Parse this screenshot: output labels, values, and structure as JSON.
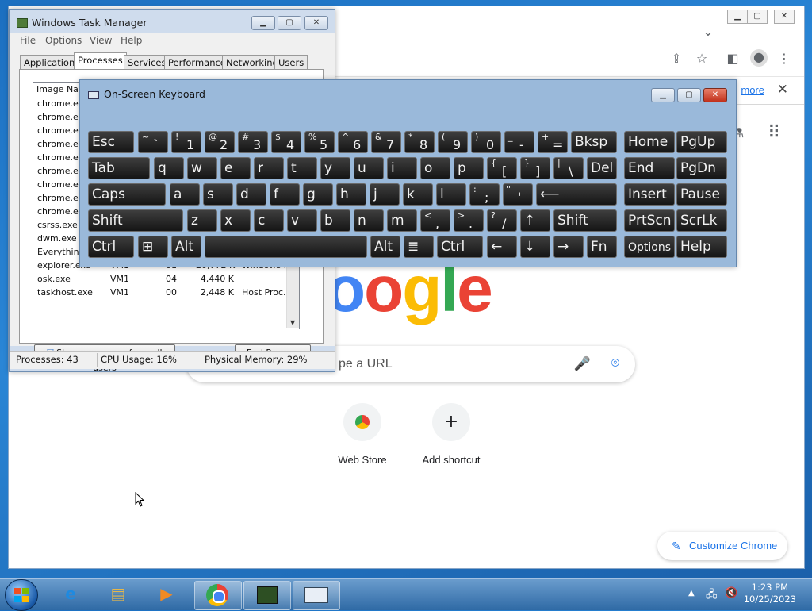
{
  "chrome": {
    "banner_link": "more",
    "banner_close": "✕",
    "search_placeholder": "pe a URL",
    "shortcuts": [
      {
        "label": "Web Store"
      },
      {
        "label": "Add shortcut",
        "icon": "+"
      }
    ],
    "customize_label": "Customize Chrome",
    "google_letters": [
      "o",
      "o",
      "g",
      "l",
      "e"
    ]
  },
  "task_manager": {
    "title": "Windows Task Manager",
    "menu": [
      "File",
      "Options",
      "View",
      "Help"
    ],
    "tabs": [
      "Applications",
      "Processes",
      "Services",
      "Performance",
      "Networking",
      "Users"
    ],
    "active_tab": "Processes",
    "column_header": "Image Nam",
    "rows": [
      {
        "name": "chrome.exe",
        "user": "",
        "cpu": "",
        "mem": "",
        "desc": ""
      },
      {
        "name": "chrome.exe",
        "user": "",
        "cpu": "",
        "mem": "",
        "desc": ""
      },
      {
        "name": "chrome.exe",
        "user": "",
        "cpu": "",
        "mem": "",
        "desc": ""
      },
      {
        "name": "chrome.exe",
        "user": "",
        "cpu": "",
        "mem": "",
        "desc": ""
      },
      {
        "name": "chrome.exe",
        "user": "",
        "cpu": "",
        "mem": "",
        "desc": ""
      },
      {
        "name": "chrome.exe",
        "user": "",
        "cpu": "",
        "mem": "",
        "desc": ""
      },
      {
        "name": "chrome.exe",
        "user": "",
        "cpu": "",
        "mem": "",
        "desc": ""
      },
      {
        "name": "chrome.exe",
        "user": "",
        "cpu": "",
        "mem": "",
        "desc": ""
      },
      {
        "name": "chrome.exe",
        "user": "",
        "cpu": "",
        "mem": "",
        "desc": ""
      },
      {
        "name": "csrss.exe",
        "user": "",
        "cpu": "",
        "mem": "",
        "desc": ""
      },
      {
        "name": "dwm.exe",
        "user": "",
        "cpu": "",
        "mem": "",
        "desc": ""
      },
      {
        "name": "Everything",
        "user": "",
        "cpu": "",
        "mem": "",
        "desc": ""
      },
      {
        "name": "explorer.exe",
        "user": "VM1",
        "cpu": "01",
        "mem": "20,772 K",
        "desc": "Windows ..."
      },
      {
        "name": "osk.exe",
        "user": "VM1",
        "cpu": "04",
        "mem": "4,440 K",
        "desc": ""
      },
      {
        "name": "taskhost.exe",
        "user": "VM1",
        "cpu": "00",
        "mem": "2,448 K",
        "desc": "Host Proc..."
      }
    ],
    "show_all_button": "Show processes from all users",
    "end_process_button": "End Process",
    "status": {
      "processes": "Processes: 43",
      "cpu": "CPU Usage: 16%",
      "memory": "Physical Memory: 29%"
    }
  },
  "osk": {
    "title": "On-Screen Keyboard",
    "rows": [
      [
        {
          "l": "Esc"
        },
        {
          "s": "~",
          "m": "`"
        },
        {
          "s": "!",
          "m": "1"
        },
        {
          "s": "@",
          "m": "2"
        },
        {
          "s": "#",
          "m": "3"
        },
        {
          "s": "$",
          "m": "4"
        },
        {
          "s": "%",
          "m": "5"
        },
        {
          "s": "^",
          "m": "6"
        },
        {
          "s": "&",
          "m": "7"
        },
        {
          "s": "*",
          "m": "8"
        },
        {
          "s": "(",
          "m": "9"
        },
        {
          "s": ")",
          "m": "0"
        },
        {
          "s": "_",
          "m": "-"
        },
        {
          "s": "+",
          "m": "="
        },
        {
          "l": "Bksp"
        },
        {
          "l": "Home"
        },
        {
          "l": "PgUp"
        }
      ],
      [
        {
          "l": "Tab"
        },
        {
          "l": "q"
        },
        {
          "l": "w"
        },
        {
          "l": "e"
        },
        {
          "l": "r"
        },
        {
          "l": "t"
        },
        {
          "l": "y"
        },
        {
          "l": "u"
        },
        {
          "l": "i"
        },
        {
          "l": "o"
        },
        {
          "l": "p"
        },
        {
          "s": "{",
          "m": "["
        },
        {
          "s": "}",
          "m": "]"
        },
        {
          "s": "|",
          "m": "\\"
        },
        {
          "l": "Del"
        },
        {
          "l": "End"
        },
        {
          "l": "PgDn"
        }
      ],
      [
        {
          "l": "Caps"
        },
        {
          "l": "a"
        },
        {
          "l": "s"
        },
        {
          "l": "d"
        },
        {
          "l": "f"
        },
        {
          "l": "g"
        },
        {
          "l": "h"
        },
        {
          "l": "j"
        },
        {
          "l": "k"
        },
        {
          "l": "l"
        },
        {
          "s": ":",
          "m": ";"
        },
        {
          "s": "\"",
          "m": "'"
        },
        {
          "l": "⟵"
        },
        {
          "l": "Insert"
        },
        {
          "l": "Pause"
        }
      ],
      [
        {
          "l": "Shift"
        },
        {
          "l": "z"
        },
        {
          "l": "x"
        },
        {
          "l": "c"
        },
        {
          "l": "v"
        },
        {
          "l": "b"
        },
        {
          "l": "n"
        },
        {
          "l": "m"
        },
        {
          "s": "<",
          "m": ","
        },
        {
          "s": ">",
          "m": "."
        },
        {
          "s": "?",
          "m": "/"
        },
        {
          "l": "↑"
        },
        {
          "l": "Shift"
        },
        {
          "l": "PrtScn"
        },
        {
          "l": "ScrLk"
        }
      ],
      [
        {
          "l": "Ctrl"
        },
        {
          "l": "⊞"
        },
        {
          "l": "Alt"
        },
        {
          "l": ""
        },
        {
          "l": "Alt"
        },
        {
          "l": "≣"
        },
        {
          "l": "Ctrl"
        },
        {
          "l": "←"
        },
        {
          "l": "↓"
        },
        {
          "l": "→"
        },
        {
          "l": "Fn"
        },
        {
          "l": "Options"
        },
        {
          "l": "Help"
        }
      ]
    ]
  },
  "taskbar": {
    "time": "1:23 PM",
    "date": "10/25/2023"
  }
}
